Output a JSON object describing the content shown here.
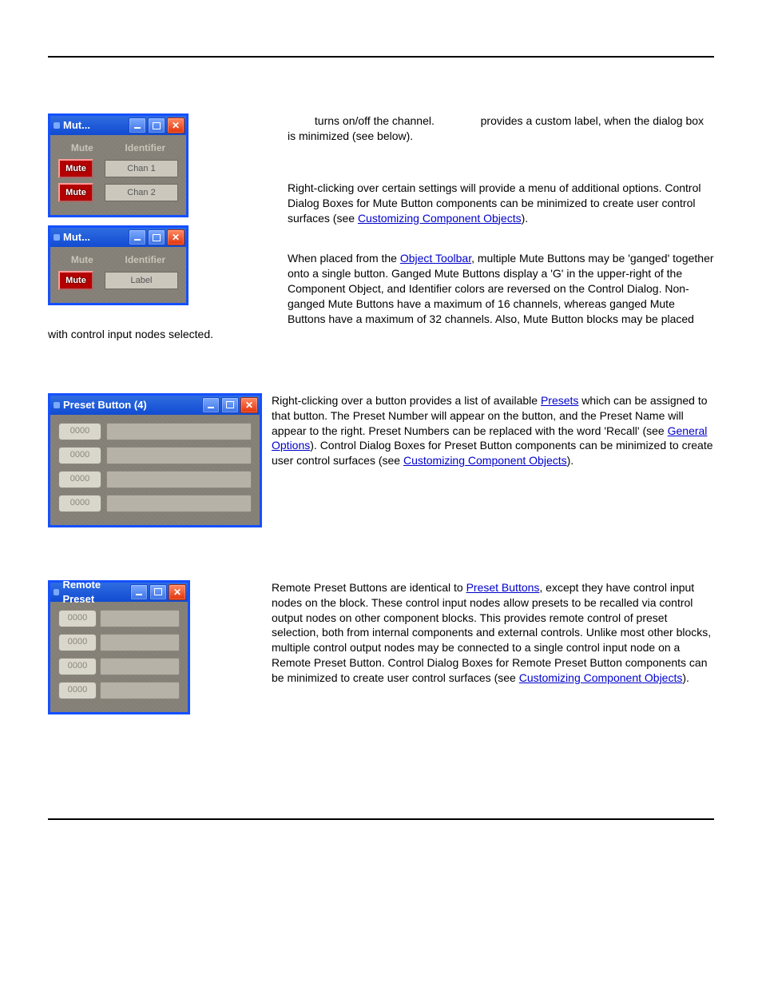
{
  "section_mute": {
    "win1": {
      "title": "Mut...",
      "headers": {
        "mute": "Mute",
        "identifier": "Identifier"
      },
      "rows": [
        {
          "btn": "Mute",
          "id": "Chan 1"
        },
        {
          "btn": "Mute",
          "id": "Chan 2"
        }
      ]
    },
    "win2": {
      "title": "Mut...",
      "headers": {
        "mute": "Mute",
        "identifier": "Identifier"
      },
      "rows": [
        {
          "btn": "Mute",
          "id": "Label"
        }
      ]
    },
    "p1_a": " turns on/off the channel. ",
    "p1_b": " provides a custom label, when the dialog box is minimized (see below).",
    "p2_a": "Right-clicking over certain settings will provide a menu of additional options. Control Dialog Boxes for Mute Button components can be minimized to create user control surfaces (see ",
    "p2_link": "Customizing Component Objects",
    "p2_b": ").",
    "p3_a": "When placed from the ",
    "p3_link": "Object Toolbar",
    "p3_b": ", multiple Mute Buttons may be 'ganged' together onto a single button. Ganged Mute Buttons display a 'G' in the upper-right of the Component Object, and Identifier colors are reversed on the Control Dialog. Non-ganged Mute Buttons have a maximum of 16 channels, whereas ganged Mute Buttons have a maximum of 32 channels. Also, Mute Button blocks may be placed with control input nodes selected."
  },
  "section_preset": {
    "win": {
      "title": "Preset Button (4)",
      "rows": [
        {
          "btn": "0000"
        },
        {
          "btn": "0000"
        },
        {
          "btn": "0000"
        },
        {
          "btn": "0000"
        }
      ]
    },
    "p_a": "Right-clicking over a button provides a list of available ",
    "p_link1": "Presets",
    "p_b": " which can be assigned to that button. The Preset Number will appear on the button, and the Preset Name will appear to the right. Preset Numbers can be replaced with the word 'Recall' (see ",
    "p_link2": "General Options",
    "p_c": "). Control Dialog Boxes for Preset Button components can be minimized to create user control surfaces (see ",
    "p_link3": "Customizing Component Objects",
    "p_d": ")."
  },
  "section_remote": {
    "win": {
      "title": "Remote Preset",
      "rows": [
        {
          "btn": "0000"
        },
        {
          "btn": "0000"
        },
        {
          "btn": "0000"
        },
        {
          "btn": "0000"
        }
      ]
    },
    "p_a": "Remote Preset Buttons are identical to ",
    "p_link1": "Preset Buttons",
    "p_b": ", except they have control input nodes on the block. These control input nodes allow presets to be recalled via control output nodes on other component blocks. This provides remote control of preset selection, both from internal components and external controls. Unlike most other blocks, multiple control output nodes may be connected to a single control input node on a Remote Preset Button. Control Dialog Boxes for Remote Preset Button components can be minimized to create user control surfaces (see ",
    "p_link2": "Customizing Component Objects",
    "p_c": ")."
  }
}
